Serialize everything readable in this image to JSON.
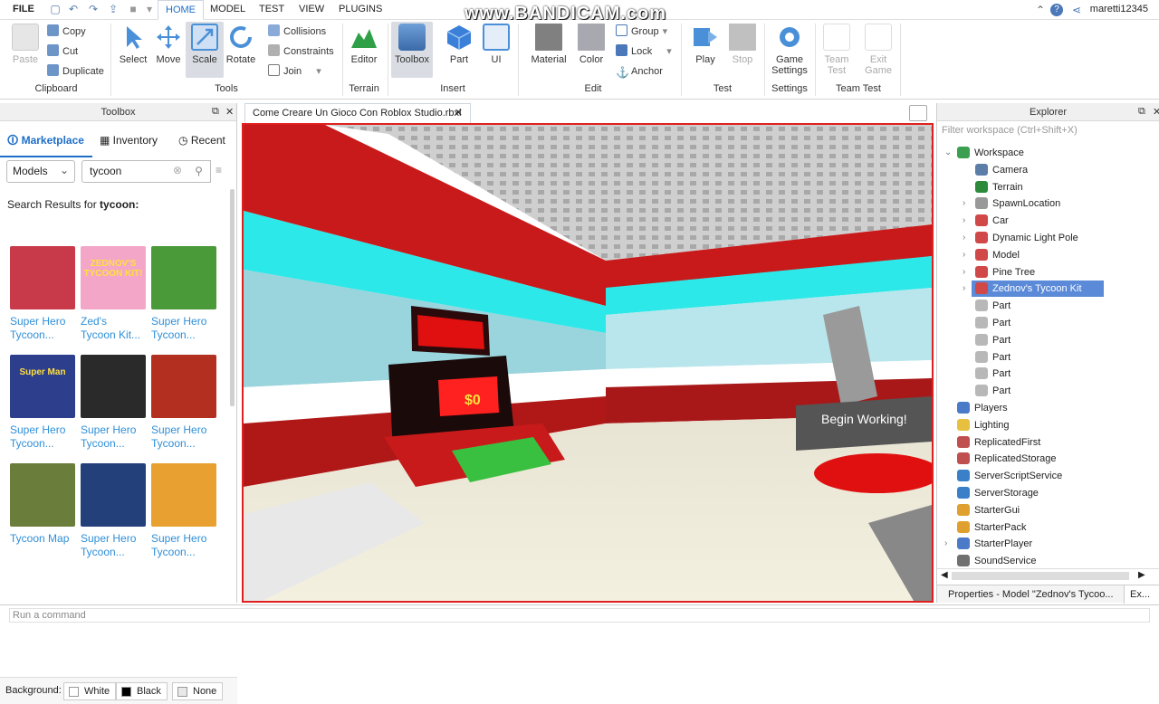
{
  "menu": {
    "file": "FILE",
    "tabs": [
      "HOME",
      "MODEL",
      "TEST",
      "VIEW",
      "PLUGINS"
    ],
    "active_tab": "HOME",
    "username": "maretti12345"
  },
  "watermark": "www.BANDICAM.com",
  "ribbon": {
    "clipboard": {
      "paste": "Paste",
      "copy": "Copy",
      "cut": "Cut",
      "duplicate": "Duplicate",
      "label": "Clipboard"
    },
    "tools": {
      "select": "Select",
      "move": "Move",
      "scale": "Scale",
      "rotate": "Rotate",
      "collisions": "Collisions",
      "constraints": "Constraints",
      "join": "Join",
      "label": "Tools"
    },
    "terrain": {
      "editor": "Editor",
      "label": "Terrain"
    },
    "insert": {
      "toolbox": "Toolbox",
      "part": "Part",
      "ui": "UI",
      "label": "Insert"
    },
    "edit": {
      "material": "Material",
      "color": "Color",
      "group": "Group",
      "lock": "Lock",
      "anchor": "Anchor",
      "label": "Edit"
    },
    "test": {
      "play": "Play",
      "stop": "Stop",
      "label": "Test"
    },
    "settings": {
      "game_settings_1": "Game",
      "game_settings_2": "Settings",
      "label": "Settings"
    },
    "team_test": {
      "team_1": "Team",
      "team_2": "Test",
      "exit_1": "Exit",
      "exit_2": "Game",
      "label": "Team Test"
    }
  },
  "toolbox": {
    "title": "Toolbox",
    "tabs": {
      "marketplace": "Marketplace",
      "inventory": "Inventory",
      "recent": "Recent"
    },
    "category": "Models",
    "search_value": "tycoon",
    "results_prefix": "Search Results for ",
    "results_query": "tycoon:",
    "items": [
      {
        "line1": "Super Hero",
        "line2": "Tycoon...",
        "color": "#c8394a"
      },
      {
        "line1": "Zed's",
        "line2": "Tycoon Kit...",
        "color": "#f3a6c8",
        "thumb_text": "ZEDNOV'S TYCOON KIT!"
      },
      {
        "line1": "Super Hero",
        "line2": "Tycoon...",
        "color": "#4a9a3a"
      },
      {
        "line1": "Super Hero",
        "line2": "Tycoon...",
        "color": "#2d3e8c",
        "thumb_text": "Super Man"
      },
      {
        "line1": "Super Hero",
        "line2": "Tycoon...",
        "color": "#2a2a2a"
      },
      {
        "line1": "Super Hero",
        "line2": "Tycoon...",
        "color": "#b33020"
      },
      {
        "line1": "Tycoon Map",
        "line2": "",
        "color": "#6b7d3a"
      },
      {
        "line1": "Super Hero",
        "line2": "Tycoon...",
        "color": "#24407a"
      },
      {
        "line1": "Super Hero",
        "line2": "Tycoon...",
        "color": "#e8a030"
      }
    ],
    "background_label": "Background:",
    "bg_options": [
      "White",
      "Black",
      "None"
    ]
  },
  "document": {
    "tab_title": "Come Creare Un Gioco Con Roblox Studio.rbxl"
  },
  "viewport": {
    "sign_text": "$0",
    "board_text": "Begin Working!"
  },
  "explorer": {
    "title": "Explorer",
    "filter_placeholder": "Filter workspace (Ctrl+Shift+X)",
    "items": [
      {
        "name": "Workspace",
        "icon": "workspace-icon",
        "color": "#3aa050"
      },
      {
        "name": "Camera",
        "icon": "camera-icon",
        "color": "#5b7ea8"
      },
      {
        "name": "Terrain",
        "icon": "terrain-icon",
        "color": "#2c8a3a"
      },
      {
        "name": "SpawnLocation",
        "icon": "spawn-icon",
        "color": "#999999"
      },
      {
        "name": "Car",
        "icon": "model-icon",
        "color": "#d04848"
      },
      {
        "name": "Dynamic Light Pole",
        "icon": "model-icon",
        "color": "#d04848"
      },
      {
        "name": "Model",
        "icon": "model-icon",
        "color": "#d04848"
      },
      {
        "name": "Pine Tree",
        "icon": "model-icon",
        "color": "#d04848"
      },
      {
        "name": "Zednov's Tycoon Kit",
        "icon": "model-icon",
        "color": "#d04848"
      },
      {
        "name": "Part",
        "icon": "part-icon",
        "color": "#b8b8b8"
      },
      {
        "name": "Part",
        "icon": "part-icon",
        "color": "#b8b8b8"
      },
      {
        "name": "Part",
        "icon": "part-icon",
        "color": "#b8b8b8"
      },
      {
        "name": "Part",
        "icon": "part-icon",
        "color": "#b8b8b8"
      },
      {
        "name": "Part",
        "icon": "part-icon",
        "color": "#b8b8b8"
      },
      {
        "name": "Part",
        "icon": "part-icon",
        "color": "#b8b8b8"
      },
      {
        "name": "Players",
        "icon": "players-icon",
        "color": "#4a7ac8"
      },
      {
        "name": "Lighting",
        "icon": "lighting-icon",
        "color": "#e8c040"
      },
      {
        "name": "ReplicatedFirst",
        "icon": "replicated-first-icon",
        "color": "#c05050"
      },
      {
        "name": "ReplicatedStorage",
        "icon": "replicated-storage-icon",
        "color": "#c05050"
      },
      {
        "name": "ServerScriptService",
        "icon": "server-script-icon",
        "color": "#3a80c8"
      },
      {
        "name": "ServerStorage",
        "icon": "server-storage-icon",
        "color": "#3a80c8"
      },
      {
        "name": "StarterGui",
        "icon": "starter-gui-icon",
        "color": "#e0a030"
      },
      {
        "name": "StarterPack",
        "icon": "starter-pack-icon",
        "color": "#e0a030"
      },
      {
        "name": "StarterPlayer",
        "icon": "starter-player-icon",
        "color": "#4a7ac8"
      },
      {
        "name": "SoundService",
        "icon": "sound-icon",
        "color": "#707070"
      }
    ],
    "selected_item": "Zednov's Tycoon Kit",
    "properties_tab": "Properties - Model \"Zednov's Tycoo...",
    "explorer_tab": "Ex..."
  },
  "command_bar": {
    "placeholder": "Run a command"
  }
}
